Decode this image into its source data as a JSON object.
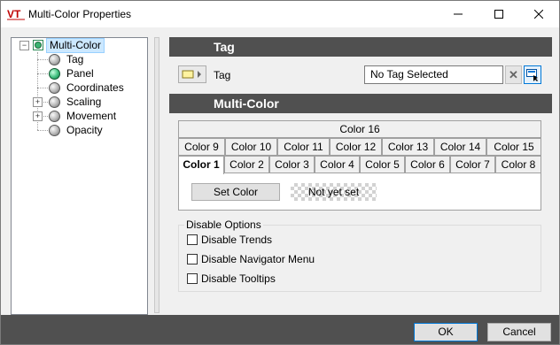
{
  "window": {
    "title": "Multi-Color Properties",
    "app_icon_text": "VT"
  },
  "tree": {
    "root": {
      "label": "Multi-Color"
    },
    "items": [
      {
        "label": "Tag",
        "icon": "gray-orb-icon"
      },
      {
        "label": "Panel",
        "icon": "green-orb-icon"
      },
      {
        "label": "Coordinates",
        "icon": "gray-orb-icon"
      },
      {
        "label": "Scaling",
        "icon": "gray-orb-icon",
        "expandable": true
      },
      {
        "label": "Movement",
        "icon": "gray-orb-icon",
        "expandable": true
      },
      {
        "label": "Opacity",
        "icon": "gray-orb-icon"
      }
    ]
  },
  "tag_section": {
    "header": "Tag",
    "label": "Tag",
    "value": "No Tag Selected"
  },
  "multicolor_section": {
    "header": "Multi-Color",
    "tab_rows": [
      [
        "Color 16"
      ],
      [
        "Color 9",
        "Color 10",
        "Color 11",
        "Color 12",
        "Color 13",
        "Color 14",
        "Color 15"
      ],
      [
        "Color 1",
        "Color 2",
        "Color 3",
        "Color 4",
        "Color 5",
        "Color 6",
        "Color 7",
        "Color 8"
      ]
    ],
    "active_tab": "Color 1",
    "set_color_label": "Set Color",
    "color_status": "Not yet set"
  },
  "disable_options": {
    "title": "Disable Options",
    "items": [
      {
        "label": "Disable Trends",
        "checked": false
      },
      {
        "label": "Disable Navigator Menu",
        "checked": false
      },
      {
        "label": "Disable Tooltips",
        "checked": false
      }
    ]
  },
  "footer": {
    "ok_label": "OK",
    "cancel_label": "Cancel"
  }
}
